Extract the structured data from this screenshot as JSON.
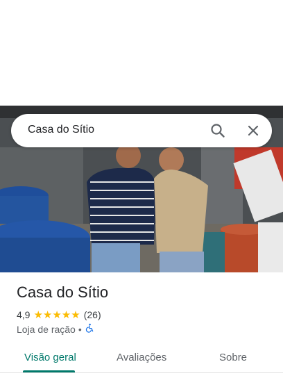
{
  "search": {
    "query": "Casa do Sítio"
  },
  "icons": {
    "search": "search-icon",
    "close": "close-icon",
    "accessibility": "wheelchair-icon",
    "star": "star-icon"
  },
  "place": {
    "name": "Casa do Sítio",
    "rating": "4,9",
    "stars": "★★★★★",
    "rating_value": 4.9,
    "reviews_count": "(26)",
    "category": "Loja de ração",
    "separator": "•"
  },
  "tabs": [
    {
      "label": "Visão geral",
      "active": true
    },
    {
      "label": "Avaliações",
      "active": false
    },
    {
      "label": "Sobre",
      "active": false
    }
  ],
  "colors": {
    "accent": "#00796b",
    "star": "#fbbc04",
    "accessibility": "#1a73e8"
  }
}
